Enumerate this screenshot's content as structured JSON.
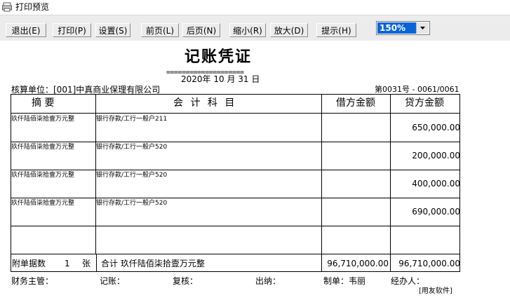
{
  "window": {
    "title": "打印预览"
  },
  "toolbar": {
    "buttons": [
      {
        "label": "退出(E)"
      },
      {
        "label": "打印(P)"
      },
      {
        "label": "设置(S)"
      },
      {
        "label": "前页(L)"
      },
      {
        "label": "后页(N)"
      },
      {
        "label": "缩小(R)"
      },
      {
        "label": "放大(D)"
      },
      {
        "label": "提示(H)"
      }
    ],
    "zoom_value": "150%"
  },
  "voucher": {
    "title": "记账凭证",
    "double_line": "====================",
    "date": "2020年  10 月  31 日",
    "unit": "核算单位：[001]中真商业保理有限公司",
    "number": "第0031号 - 0061/0061",
    "headers": {
      "summary": "摘    要",
      "account": "会 计 科 目",
      "debit": "借方金额",
      "credit": "贷方金额"
    },
    "rows": [
      {
        "summary": "玖仟陆佰柒拾壹万元整",
        "account": "银行存款/工行一般户211",
        "debit": "",
        "credit": "650,000.00"
      },
      {
        "summary": "玖仟陆佰柒拾壹万元整",
        "account": "银行存款/工行一般户520",
        "debit": "",
        "credit": "200,000.00"
      },
      {
        "summary": "玖仟陆佰柒拾壹万元整",
        "account": "银行存款/工行一般户520",
        "debit": "",
        "credit": "400,000.00"
      },
      {
        "summary": "玖仟陆佰柒拾壹万元整",
        "account": "银行存款/工行一般户520",
        "debit": "",
        "credit": "690,000.00"
      },
      {
        "summary": "",
        "account": "",
        "debit": "",
        "credit": ""
      }
    ],
    "attach": {
      "label": "附单据数",
      "count": "1",
      "unit": "张"
    },
    "total": {
      "label": "合计 玖仟陆佰柒拾壹万元整",
      "debit": "96,710,000.00",
      "credit": "96,710,000.00"
    },
    "signatures": {
      "finance": "财务主管：",
      "bookkeeper": "记账：",
      "review": "复核：",
      "cashier": "出纳：",
      "maker": "制单：韦丽",
      "handler": "经办人："
    },
    "footer": "[用友软件]"
  }
}
